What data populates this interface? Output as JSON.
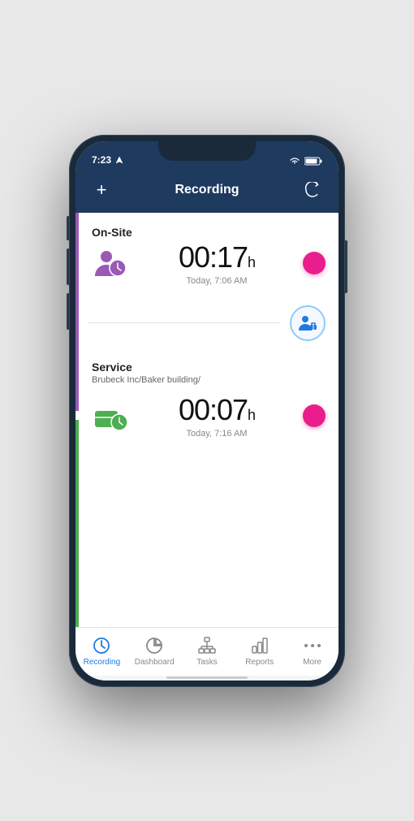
{
  "statusBar": {
    "time": "7:23",
    "locationIcon": "location-arrow-icon"
  },
  "header": {
    "title": "Recording",
    "addLabel": "+",
    "refreshIcon": "refresh-icon"
  },
  "cards": [
    {
      "type": "On-Site",
      "subtitle": "",
      "time": "00:17",
      "unit": "h",
      "date": "Today, 7:06 AM",
      "iconColor": "#9b59b6",
      "iconType": "person-clock-icon",
      "recordBtnColor": "#e91e8c"
    },
    {
      "type": "Service",
      "subtitle": "Brubeck Inc/Baker building/",
      "time": "00:07",
      "unit": "h",
      "date": "Today, 7:16 AM",
      "iconColor": "#4caf50",
      "iconType": "briefcase-clock-icon",
      "recordBtnColor": "#e91e8c"
    }
  ],
  "floatButton": {
    "icon": "person-briefcase-icon"
  },
  "bottomNav": [
    {
      "label": "Recording",
      "icon": "clock-circle-icon",
      "active": true
    },
    {
      "label": "Dashboard",
      "icon": "pie-chart-icon",
      "active": false
    },
    {
      "label": "Tasks",
      "icon": "org-chart-icon",
      "active": false
    },
    {
      "label": "Reports",
      "icon": "bar-chart-icon",
      "active": false
    },
    {
      "label": "More",
      "icon": "dots-icon",
      "active": false
    }
  ]
}
